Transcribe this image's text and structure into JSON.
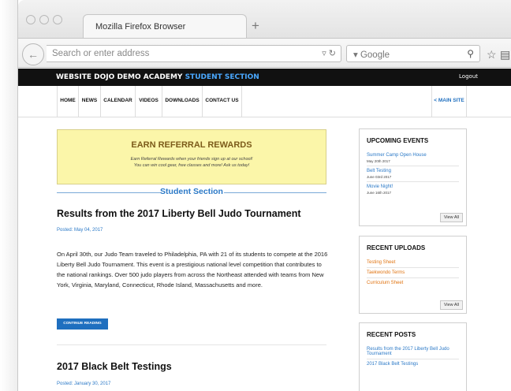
{
  "browser": {
    "tab_title": "Mozilla Firefox Browser",
    "new_tab": "+",
    "address_placeholder": "Search or enter address",
    "search_placeholder": "Google"
  },
  "site": {
    "brand": "WEBSITE DOJO DEMO ACADEMY",
    "brand_accent": "STUDENT SECTION",
    "logout": "Logout",
    "nav": [
      "HOME",
      "NEWS",
      "CALENDAR",
      "VIDEOS",
      "DOWNLOADS",
      "CONTACT US"
    ],
    "main_site": "< MAIN SITE",
    "promo_title": "EARN REFERRAL REWARDS",
    "promo_line1": "Earn Referral Rewards when your friends sign up at our school!",
    "promo_line2": "You can win cool gear, free classes and more! Ask us today!",
    "section_title": "Student Section",
    "post1_title": "Results from the 2017 Liberty Bell Judo Tournament",
    "post1_date": "Posted: May 04, 2017",
    "post1_body": "On April 30th, our Judo Team traveled to Philadelphia, PA with 21 of its students to compete at the 2016 Liberty Bell Judo Tournament. This event is a prestigious national level competition that contributes to the national rankings. Over 500 judo players from across the Northeast attended with teams from New York, Virginia, Maryland, Connecticut, Rhode Island, Massachusetts and more.",
    "continue_reading": "CONTINUE READING",
    "post2_title": "2017 Black Belt Testings",
    "post2_date": "Posted: January 30, 2017"
  },
  "sidebar": {
    "events_title": "UPCOMING EVENTS",
    "events": [
      {
        "title": "Summer Camp Open House",
        "date": "May 20th 2017"
      },
      {
        "title": "Belt Testing",
        "date": "June 03rd 2017"
      },
      {
        "title": "Movie Night!",
        "date": "June 16th 2017"
      }
    ],
    "uploads_title": "RECENT UPLOADS",
    "uploads": [
      "Testing Sheet",
      "Taekwondo Terms",
      "Curriculum Sheet"
    ],
    "posts_title": "RECENT POSTS",
    "posts": [
      "Results from the 2017 Liberty Bell Judo Tournament",
      "2017 Black Belt Testings"
    ],
    "view_all": "View All"
  },
  "colors": {
    "accent": "#2b79c7",
    "promo_bg": "#fbf6a9",
    "upload_link": "#e07412"
  }
}
